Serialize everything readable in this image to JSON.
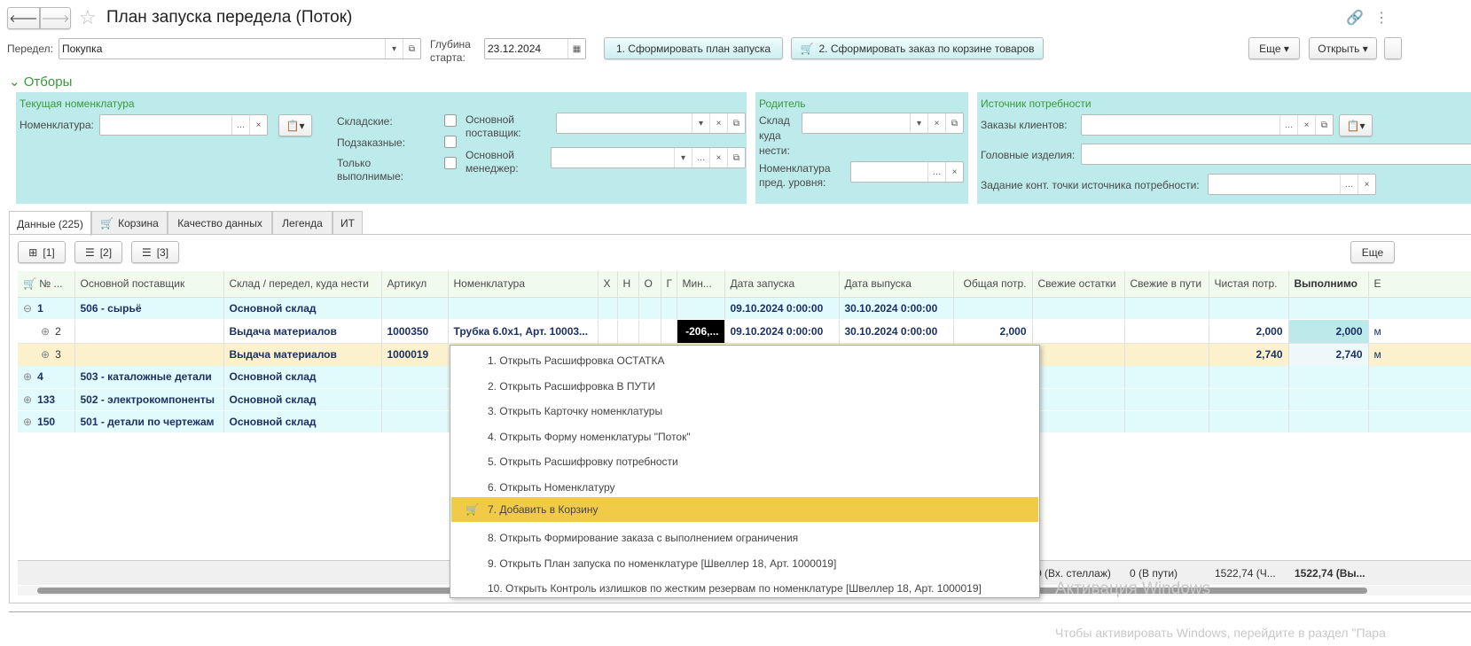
{
  "window": {
    "title": "План запуска передела (Поток)"
  },
  "header": {
    "peredel_label": "Передел:",
    "peredel_value": "Покупка",
    "depth_label": "Глубина старта:",
    "depth_value": "23.12.2024",
    "btn_form_plan": "1. Сформировать план запуска",
    "btn_form_order": "2. Сформировать заказ по корзине товаров",
    "btn_more": "Еще ▾",
    "btn_open": "Открыть ▾"
  },
  "filters": {
    "toggle": "Отборы",
    "current": {
      "title": "Текущая номенклатура",
      "nomenclature_label": "Номенклатура:",
      "skladskie": "Складские:",
      "podzakaznye": "Подзаказные:",
      "tolko": "Только выполнимые:",
      "supplier": "Основной поставщик:",
      "manager": "Основной менеджер:"
    },
    "parent": {
      "title": "Родитель",
      "sklad": "Склад куда нести:",
      "nom_level": "Номенклатура пред. уровня:"
    },
    "source": {
      "title": "Источник потребности",
      "orders": "Заказы клиентов:",
      "head": "Головные изделия:",
      "task": "Задание конт. точки источника потребности:"
    }
  },
  "tabs": [
    "Данные (225)",
    "Корзина",
    "Качество данных",
    "Легенда",
    "ИТ"
  ],
  "toolbar": {
    "b1": "[1]",
    "b2": "[2]",
    "b3": "[3]",
    "more": "Еще"
  },
  "table": {
    "columns": [
      "№ ...",
      "Основной поставщик",
      "Склад / передел, куда нести",
      "Артикул",
      "Номенклатура",
      "Х",
      "Н",
      "О",
      "Г",
      "Мин...",
      "Дата запуска",
      "Дата выпуска",
      "Общая потр.",
      "Свежие остатки",
      "Свежие в пути",
      "Чистая потр.",
      "Выполнимо",
      "Е"
    ],
    "rows": [
      {
        "no": "1",
        "supplier": "506 - сырьё",
        "sklad": "Основной склад",
        "art": "",
        "nom": "",
        "min": "",
        "start": "09.10.2024 0:00:00",
        "end": "30.10.2024 0:00:00",
        "total": "",
        "fresh": "",
        "transit": "",
        "net": "",
        "done": "",
        "e": ""
      },
      {
        "no": "2",
        "supplier": "",
        "sklad": "Выдача материалов",
        "art": "1000350",
        "nom": "Трубка 6.0х1, Арт. 10003...",
        "min": "-206,...",
        "start": "09.10.2024 0:00:00",
        "end": "30.10.2024 0:00:00",
        "total": "2,000",
        "fresh": "",
        "transit": "",
        "net": "2,000",
        "done": "2,000",
        "e": "м"
      },
      {
        "no": "3",
        "supplier": "",
        "sklad": "Выдача материалов",
        "art": "1000019",
        "nom": "",
        "min": "",
        "start": "",
        "end": "",
        "total": "",
        "fresh": "",
        "transit": "",
        "net": "2,740",
        "done": "2,740",
        "e": "м"
      },
      {
        "no": "4",
        "supplier": "503 - каталожные детали",
        "sklad": "Основной склад"
      },
      {
        "no": "133",
        "supplier": "502 - электрокомпоненты",
        "sklad": "Основной склад"
      },
      {
        "no": "150",
        "supplier": "501 - детали по чертежам",
        "sklad": "Основной склад"
      }
    ],
    "footer": {
      "fresh": "0 (Вх. стеллаж)",
      "transit": "0 (В пути)",
      "net": "1522,74 (Ч...",
      "done": "1522,74 (Вы..."
    }
  },
  "context_menu": [
    "1. Открыть Расшифровка ОСТАТКА",
    "2. Открыть Расшифровка В ПУТИ",
    "3. Открыть Карточку номенклатуры",
    "4. Открыть Форму номенклатуры \"Поток\"",
    "5. Открыть Расшифровку потребности",
    "6. Открыть Номенклатуру",
    "7. Добавить в Корзину",
    "8. Открыть Формирование заказа с выполнением ограничения",
    "9. Открыть План запуска по номенклатуре [Швеллер 18, Арт. 1000019]",
    "10. Открыть Контроль излишков по жестким резервам по номенклатуре [Швеллер 18, Арт. 1000019]"
  ],
  "watermark": {
    "line1": "Активация Windows",
    "line2": "Чтобы активировать Windows, перейдите в раздел \"Пара"
  },
  "colors": {
    "panel": "#bdeaeb",
    "highlight": "#f1cb48",
    "selected_row": "#fbf1cc",
    "group_row": "#e1fbfc"
  }
}
